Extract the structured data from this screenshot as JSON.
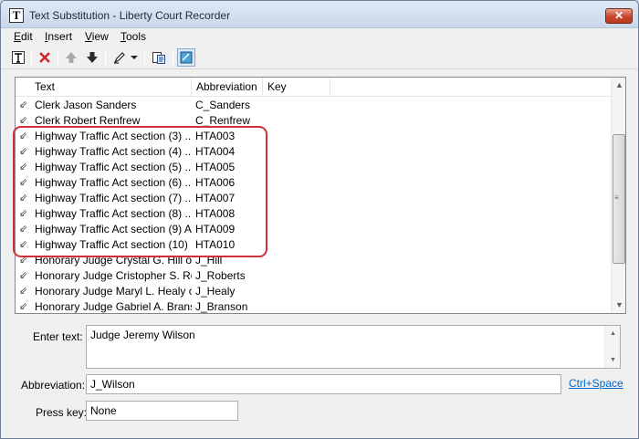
{
  "window": {
    "title": "Text Substitution - Liberty Court Recorder",
    "app_icon_glyph": "T",
    "close_glyph": "✕"
  },
  "menu": [
    {
      "label": "Edit",
      "u": "E",
      "rest": "dit"
    },
    {
      "label": "Insert",
      "u": "I",
      "rest": "nsert"
    },
    {
      "label": "View",
      "u": "V",
      "rest": "iew"
    },
    {
      "label": "Tools",
      "u": "T",
      "rest": "ools"
    }
  ],
  "toolbar": {
    "icons": [
      "new-text-icon",
      "delete-icon",
      "move-up-icon",
      "move-down-icon",
      "highlighter-icon",
      "dropdown-arrow-icon",
      "paste-icon",
      "view-toggle-icon"
    ]
  },
  "list": {
    "columns": [
      "Text",
      "Abbreviation",
      "Key"
    ],
    "rows": [
      {
        "text": "Clerk Jason Sanders",
        "abbr": "C_Sanders",
        "key": ""
      },
      {
        "text": "Clerk Robert Renfrew",
        "abbr": "C_Renfrew",
        "key": ""
      },
      {
        "text": "Highway Traffic Act section (3)   ...",
        "abbr": "HTA003",
        "key": ""
      },
      {
        "text": "Highway Traffic Act section (4)   ...",
        "abbr": "HTA004",
        "key": ""
      },
      {
        "text": "Highway Traffic Act section (5)   ...",
        "abbr": "HTA005",
        "key": ""
      },
      {
        "text": "Highway Traffic Act section (6)   ...",
        "abbr": "HTA006",
        "key": ""
      },
      {
        "text": "Highway Traffic Act section (7)   ...",
        "abbr": "HTA007",
        "key": ""
      },
      {
        "text": "Highway Traffic Act section (8)   ...",
        "abbr": "HTA008",
        "key": ""
      },
      {
        "text": "Highway Traffic Act section (9) A...",
        "abbr": "HTA009",
        "key": ""
      },
      {
        "text": "Highway Traffic Act section (10) ...",
        "abbr": "HTA010",
        "key": ""
      },
      {
        "text": "Honorary Judge Crystal G. Hill of ...",
        "abbr": "J_Hill",
        "key": ""
      },
      {
        "text": "Honorary Judge Cristopher S. Ro...",
        "abbr": "J_Roberts",
        "key": ""
      },
      {
        "text": "Honorary Judge Maryl L. Healy o...",
        "abbr": "J_Healy",
        "key": ""
      },
      {
        "text": "Honorary Judge Gabriel A. Brans...",
        "abbr": "J_Branson",
        "key": ""
      }
    ],
    "row_icon_glyph": "⇙"
  },
  "form": {
    "enter_text_label": "Enter text:",
    "enter_text_value": "Judge Jeremy Wilson",
    "abbreviation_label": "Abbreviation:",
    "abbreviation_value": "J_Wilson",
    "shortcut_link": "Ctrl+Space",
    "press_key_label": "Press key:",
    "press_key_value": "None"
  },
  "colors": {
    "highlight_border": "#d0303a",
    "link": "#0066cc"
  }
}
